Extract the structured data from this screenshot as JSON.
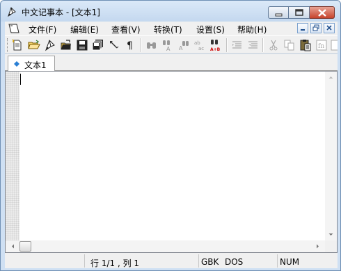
{
  "window": {
    "title": "中文记事本 - [文本1]",
    "accent_color": "#c4d8ef",
    "close_color": "#c7432c"
  },
  "menu": {
    "items": [
      {
        "label": "文件(F)"
      },
      {
        "label": "编辑(E)"
      },
      {
        "label": "查看(V)"
      },
      {
        "label": "转换(T)"
      },
      {
        "label": "设置(S)"
      },
      {
        "label": "帮助(H)"
      }
    ]
  },
  "toolbar": {
    "icons": [
      "new-icon",
      "open-icon",
      "reopen-icon",
      "open-folder-icon",
      "save-icon",
      "save-all-icon",
      "edit-tool-icon",
      "pilcrow-icon",
      "find-icon",
      "find-next-icon",
      "find-prev-icon",
      "replace-icon",
      "convert-icon",
      "indent-icon",
      "outdent-icon",
      "cut-icon",
      "copy-icon",
      "paste-icon",
      "insert-field-icon",
      "insert-special-icon"
    ]
  },
  "tabs": [
    {
      "label": "文本1",
      "active": true
    }
  ],
  "editor": {
    "content": ""
  },
  "status": {
    "position": "行 1/1 , 列 1",
    "encoding": "GBK",
    "line_ending": "DOS",
    "num_lock": "NUM"
  }
}
